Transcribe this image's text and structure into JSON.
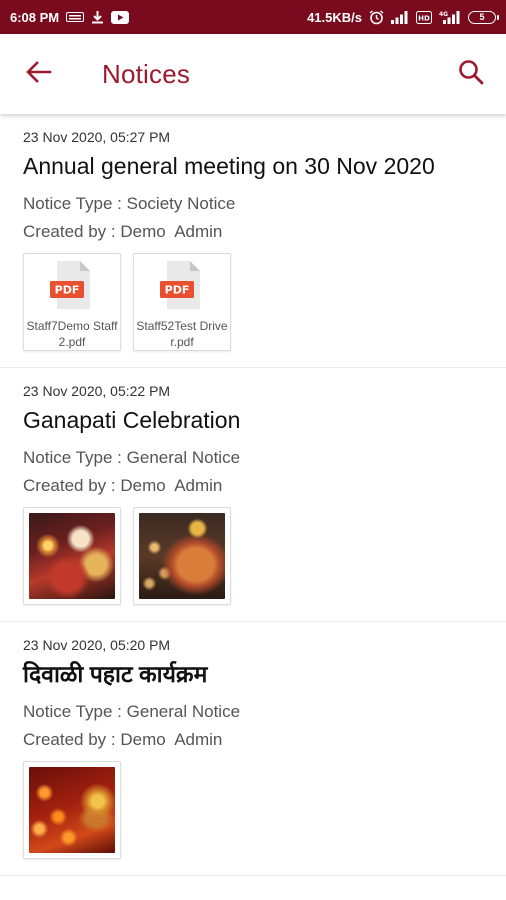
{
  "status_bar": {
    "time": "6:08 PM",
    "left_icons": [
      "sim-card-icon",
      "download-icon",
      "youtube-icon"
    ],
    "network_speed": "41.5KB/s",
    "right_icons": [
      "alarm-icon",
      "signal-icon",
      "volte-icon",
      "4g-signal-icon"
    ],
    "battery_level": "5"
  },
  "app_bar": {
    "title": "Notices",
    "back_icon": "arrow-left-icon",
    "search_icon": "search-icon",
    "accent_color": "#9c1a2e",
    "status_color": "#7a0b1e"
  },
  "notices": [
    {
      "date": "23 Nov 2020, 05:27 PM",
      "title": "Annual general meeting on 30 Nov 2020",
      "type_label": "Notice Type :",
      "type_value": "Society Notice",
      "created_label": "Created by :",
      "created_value": "Demo  Admin",
      "attachments": [
        {
          "kind": "pdf",
          "badge": "PDF",
          "name": "Staff7Demo Staff 2.pdf"
        },
        {
          "kind": "pdf",
          "badge": "PDF",
          "name": "Staff52Test Driver.pdf"
        }
      ]
    },
    {
      "date": "23 Nov 2020, 05:22 PM",
      "title": "Ganapati Celebration",
      "type_label": "Notice Type :",
      "type_value": "General Notice",
      "created_label": "Created by :",
      "created_value": "Demo  Admin",
      "attachments": [
        {
          "kind": "image",
          "name": ""
        },
        {
          "kind": "image",
          "name": ""
        }
      ]
    },
    {
      "date": "23 Nov 2020, 05:20 PM",
      "title": "दिवाळी पहाट कार्यक्रम",
      "type_label": "Notice Type :",
      "type_value": "General Notice",
      "created_label": "Created by :",
      "created_value": "Demo  Admin",
      "attachments": [
        {
          "kind": "image",
          "name": ""
        }
      ]
    }
  ]
}
